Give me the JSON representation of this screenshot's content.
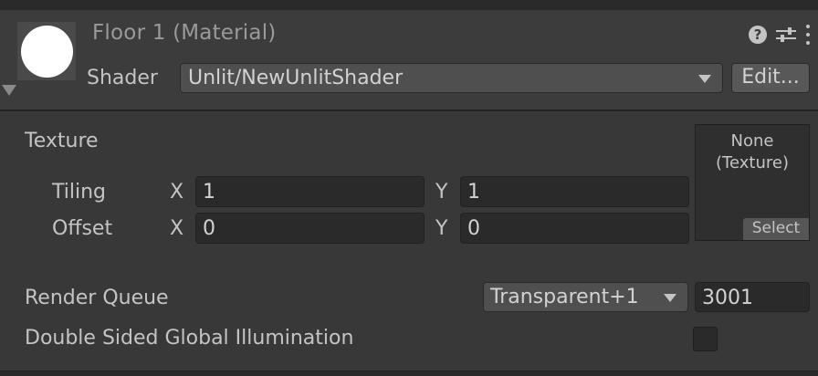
{
  "header": {
    "title": "Floor 1 (Material)",
    "shader_label": "Shader",
    "shader_value": "Unlit/NewUnlitShader",
    "edit_label": "Edit...",
    "icons": [
      "help-icon",
      "sliders-icon",
      "kebab-menu-icon"
    ]
  },
  "texture": {
    "label": "Texture",
    "tiling_label": "Tiling",
    "offset_label": "Offset",
    "x_label": "X",
    "y_label": "Y",
    "tiling_x": "1",
    "tiling_y": "1",
    "offset_x": "0",
    "offset_y": "0",
    "slot_line1": "None",
    "slot_line2": "(Texture)",
    "select_label": "Select"
  },
  "render_queue": {
    "label": "Render Queue",
    "dropdown_value": "Transparent+1",
    "value": "3001"
  },
  "double_sided_gi": {
    "label": "Double Sided Global Illumination",
    "checked": false
  }
}
